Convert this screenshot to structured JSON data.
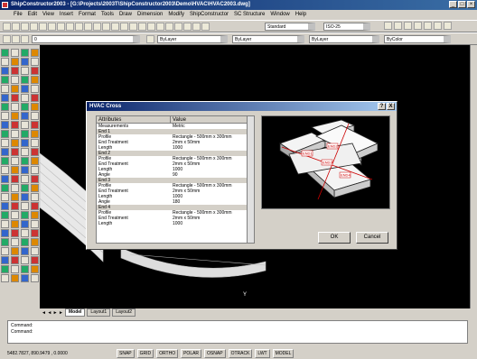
{
  "window": {
    "title": "ShipConstructor2003 - [G:\\Projects\\2003T\\ShipConstructor2003\\Demo\\HVAC\\HVAC2003.dwg]",
    "controls": {
      "minimize": "_",
      "maximize": "□",
      "close": "×"
    }
  },
  "menu": [
    "File",
    "Edit",
    "View",
    "Insert",
    "Format",
    "Tools",
    "Draw",
    "Dimension",
    "Modify",
    "ShipConstructor",
    "SC Structure",
    "Window",
    "Help"
  ],
  "toolbar2": {
    "style_combo": "Standard",
    "dim_combo": "ISO-25"
  },
  "toolbar3": {
    "layer_combo": "0",
    "color_combo": "ByLayer",
    "linetype_combo": "ByLayer",
    "lineweight_combo": "ByLayer",
    "plotstyle_combo": "ByColor"
  },
  "layout_tabs": [
    "Model",
    "Layout1",
    "Layout2"
  ],
  "command": {
    "line1": "Command:",
    "line2": "Command:"
  },
  "status": {
    "coords": "5482.7827, 890.9479 , 0.0000",
    "buttons": [
      "SNAP",
      "GRID",
      "ORTHO",
      "POLAR",
      "OSNAP",
      "OTRACK",
      "LWT",
      "MODEL"
    ]
  },
  "dialog": {
    "title": "HVAC Cross",
    "help_btn": "?",
    "close_btn": "X",
    "columns": {
      "attribute": "Attributes",
      "value": "Value"
    },
    "rows": [
      {
        "a": "Measurements",
        "v": "Metric",
        "s": false
      },
      {
        "a": "End 1",
        "v": "",
        "s": true
      },
      {
        "a": "Profile",
        "v": "Rectangle - 500mm x 300mm",
        "s": false
      },
      {
        "a": "End Treatment",
        "v": "2mm x 50mm",
        "s": false
      },
      {
        "a": "Length",
        "v": "1000",
        "s": false
      },
      {
        "a": "End 2",
        "v": "",
        "s": true
      },
      {
        "a": "Profile",
        "v": "Rectangle - 500mm x 300mm",
        "s": false
      },
      {
        "a": "End Treatment",
        "v": "2mm x 50mm",
        "s": false
      },
      {
        "a": "Length",
        "v": "1000",
        "s": false
      },
      {
        "a": "Angle",
        "v": "90",
        "s": false
      },
      {
        "a": "End 3",
        "v": "",
        "s": true
      },
      {
        "a": "Profile",
        "v": "Rectangle - 500mm x 300mm",
        "s": false
      },
      {
        "a": "End Treatment",
        "v": "2mm x 50mm",
        "s": false
      },
      {
        "a": "Length",
        "v": "1000",
        "s": false
      },
      {
        "a": "Angle",
        "v": "180",
        "s": false
      },
      {
        "a": "End 4",
        "v": "",
        "s": true
      },
      {
        "a": "Profile",
        "v": "Rectangle - 500mm x 300mm",
        "s": false
      },
      {
        "a": "End Treatment",
        "v": "2mm x 50mm",
        "s": false
      },
      {
        "a": "Length",
        "v": "1000",
        "s": false
      }
    ],
    "preview_labels": [
      "END1",
      "END2",
      "END3",
      "END4"
    ],
    "ok": "OK",
    "cancel": "Cancel"
  }
}
